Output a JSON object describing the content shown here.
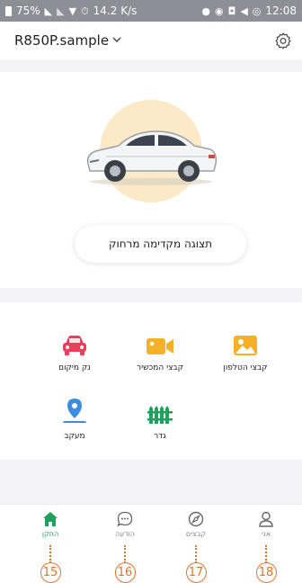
{
  "status_bar": {
    "battery": "75%",
    "speed": "14.2 K/s",
    "time": "12:08"
  },
  "header": {
    "device_name": "R850P.sample",
    "chevron": "chevron-down-icon",
    "settings_icon": "gear-icon"
  },
  "hero": {
    "preview_label": "תצוגה מקדימה מרחוק"
  },
  "grid": {
    "items": [
      {
        "label": "קבצי הטלפון",
        "icon": "photo-icon",
        "color": "#f5b128"
      },
      {
        "label": "קבצי המכשיר",
        "icon": "video-camera-icon",
        "color": "#f5b128"
      },
      {
        "label": "נק מיקום",
        "icon": "car-icon",
        "color": "#ee3d5b"
      },
      {
        "label": "גדר",
        "icon": "fence-icon",
        "color": "#1fa25c"
      },
      {
        "label": "מעקב",
        "icon": "location-pin-icon",
        "color": "#3a8de0"
      }
    ]
  },
  "bottom_nav": {
    "items": [
      {
        "label": "אני",
        "icon": "person-icon"
      },
      {
        "label": "קבצים",
        "icon": "compass-icon"
      },
      {
        "label": "הודעה",
        "icon": "message-icon"
      },
      {
        "label": "התקן",
        "icon": "home-icon",
        "active": true
      }
    ]
  },
  "callouts": [
    "15",
    "16",
    "17",
    "18"
  ],
  "colors": {
    "accent": "#1fa25c",
    "callout": "#e8732b",
    "hero_circle": "#fbe9c8"
  }
}
